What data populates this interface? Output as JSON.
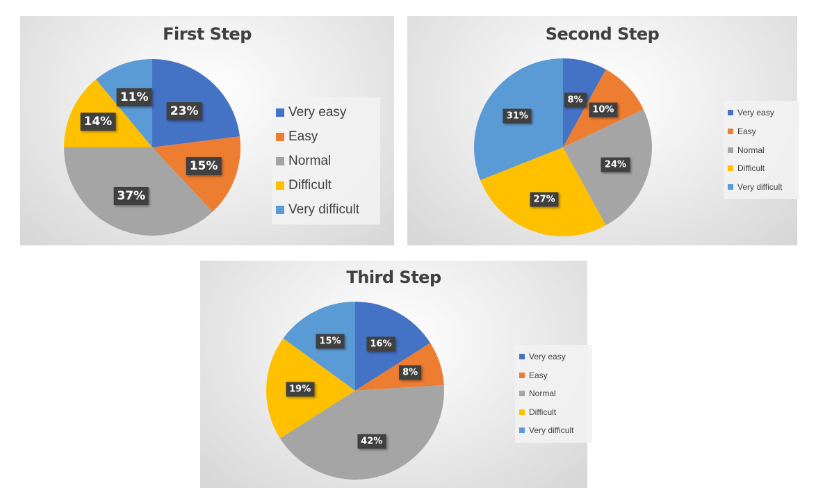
{
  "chart_data": [
    {
      "type": "pie",
      "title": "First Step",
      "categories": [
        "Very easy",
        "Easy",
        "Normal",
        "Difficult",
        "Very difficult"
      ],
      "values": [
        23,
        15,
        37,
        14,
        11
      ],
      "data_labels": [
        "23%",
        "15%",
        "37%",
        "14%",
        "11%"
      ],
      "colors": [
        "#4472C4",
        "#ED7D31",
        "#A5A5A5",
        "#FFC000",
        "#5B9BD5"
      ],
      "legend_position": "right"
    },
    {
      "type": "pie",
      "title": "Second Step",
      "categories": [
        "Very easy",
        "Easy",
        "Normal",
        "Difficult",
        "Very difficult"
      ],
      "values": [
        8,
        10,
        24,
        27,
        31
      ],
      "data_labels": [
        "8%",
        "10%",
        "24%",
        "27%",
        "31%"
      ],
      "colors": [
        "#4472C4",
        "#ED7D31",
        "#A5A5A5",
        "#FFC000",
        "#5B9BD5"
      ],
      "legend_position": "right"
    },
    {
      "type": "pie",
      "title": "Third Step",
      "categories": [
        "Very easy",
        "Easy",
        "Normal",
        "Difficult",
        "Very difficult"
      ],
      "values": [
        16,
        8,
        42,
        19,
        15
      ],
      "data_labels": [
        "16%",
        "8%",
        "42%",
        "19%",
        "15%"
      ],
      "colors": [
        "#4472C4",
        "#ED7D31",
        "#A5A5A5",
        "#FFC000",
        "#5B9BD5"
      ],
      "legend_position": "right"
    }
  ]
}
